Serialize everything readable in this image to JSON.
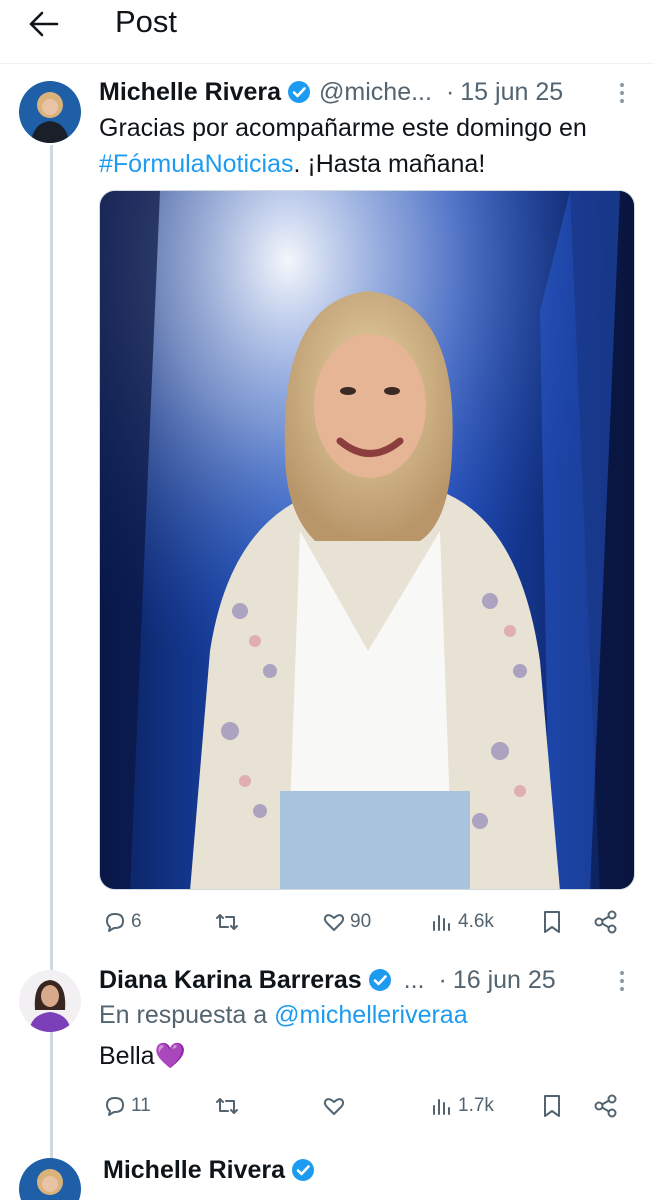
{
  "header": {
    "title": "Post"
  },
  "tweet1": {
    "name": "Michelle Rivera",
    "handle": "@miche...",
    "separator": "·",
    "date": "15 jun 25",
    "text_before": "Gracias por acompañarme este domingo en ",
    "hashtag": "#FórmulaNoticias",
    "text_after": ". ¡Hasta mañana!",
    "actions": {
      "replies": "6",
      "reposts": "",
      "likes": "90",
      "views": "4.6k"
    }
  },
  "tweet2": {
    "name": "Diana Karina Barreras",
    "handle": "...",
    "separator": "·",
    "date": "16 jun 25",
    "reply_prefix": "En respuesta a ",
    "reply_mention": "@michelleriveraa",
    "text": "Bella💜",
    "actions": {
      "replies": "11",
      "reposts": "",
      "likes": "",
      "views": "1.7k"
    }
  },
  "tweet3": {
    "name": "Michelle Rivera"
  },
  "colors": {
    "accent": "#1d9bf0",
    "muted": "#536471",
    "text": "#0f1419",
    "thread": "#cfd9de"
  }
}
